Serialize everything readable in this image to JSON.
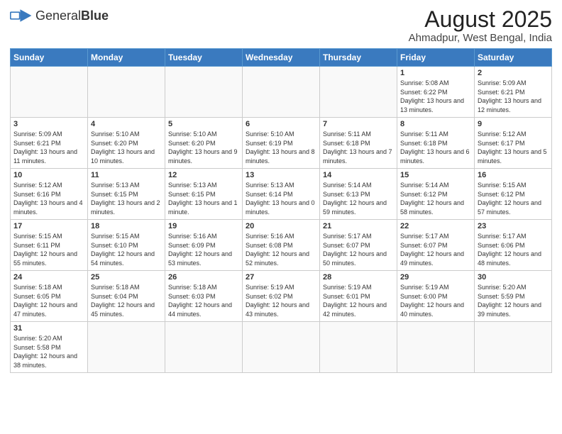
{
  "header": {
    "logo_text_normal": "General",
    "logo_text_bold": "Blue",
    "title": "August 2025",
    "subtitle": "Ahmadpur, West Bengal, India"
  },
  "weekdays": [
    "Sunday",
    "Monday",
    "Tuesday",
    "Wednesday",
    "Thursday",
    "Friday",
    "Saturday"
  ],
  "weeks": [
    [
      {
        "day": "",
        "info": ""
      },
      {
        "day": "",
        "info": ""
      },
      {
        "day": "",
        "info": ""
      },
      {
        "day": "",
        "info": ""
      },
      {
        "day": "",
        "info": ""
      },
      {
        "day": "1",
        "info": "Sunrise: 5:08 AM\nSunset: 6:22 PM\nDaylight: 13 hours and 13 minutes."
      },
      {
        "day": "2",
        "info": "Sunrise: 5:09 AM\nSunset: 6:21 PM\nDaylight: 13 hours and 12 minutes."
      }
    ],
    [
      {
        "day": "3",
        "info": "Sunrise: 5:09 AM\nSunset: 6:21 PM\nDaylight: 13 hours and 11 minutes."
      },
      {
        "day": "4",
        "info": "Sunrise: 5:10 AM\nSunset: 6:20 PM\nDaylight: 13 hours and 10 minutes."
      },
      {
        "day": "5",
        "info": "Sunrise: 5:10 AM\nSunset: 6:20 PM\nDaylight: 13 hours and 9 minutes."
      },
      {
        "day": "6",
        "info": "Sunrise: 5:10 AM\nSunset: 6:19 PM\nDaylight: 13 hours and 8 minutes."
      },
      {
        "day": "7",
        "info": "Sunrise: 5:11 AM\nSunset: 6:18 PM\nDaylight: 13 hours and 7 minutes."
      },
      {
        "day": "8",
        "info": "Sunrise: 5:11 AM\nSunset: 6:18 PM\nDaylight: 13 hours and 6 minutes."
      },
      {
        "day": "9",
        "info": "Sunrise: 5:12 AM\nSunset: 6:17 PM\nDaylight: 13 hours and 5 minutes."
      }
    ],
    [
      {
        "day": "10",
        "info": "Sunrise: 5:12 AM\nSunset: 6:16 PM\nDaylight: 13 hours and 4 minutes."
      },
      {
        "day": "11",
        "info": "Sunrise: 5:13 AM\nSunset: 6:15 PM\nDaylight: 13 hours and 2 minutes."
      },
      {
        "day": "12",
        "info": "Sunrise: 5:13 AM\nSunset: 6:15 PM\nDaylight: 13 hours and 1 minute."
      },
      {
        "day": "13",
        "info": "Sunrise: 5:13 AM\nSunset: 6:14 PM\nDaylight: 13 hours and 0 minutes."
      },
      {
        "day": "14",
        "info": "Sunrise: 5:14 AM\nSunset: 6:13 PM\nDaylight: 12 hours and 59 minutes."
      },
      {
        "day": "15",
        "info": "Sunrise: 5:14 AM\nSunset: 6:12 PM\nDaylight: 12 hours and 58 minutes."
      },
      {
        "day": "16",
        "info": "Sunrise: 5:15 AM\nSunset: 6:12 PM\nDaylight: 12 hours and 57 minutes."
      }
    ],
    [
      {
        "day": "17",
        "info": "Sunrise: 5:15 AM\nSunset: 6:11 PM\nDaylight: 12 hours and 55 minutes."
      },
      {
        "day": "18",
        "info": "Sunrise: 5:15 AM\nSunset: 6:10 PM\nDaylight: 12 hours and 54 minutes."
      },
      {
        "day": "19",
        "info": "Sunrise: 5:16 AM\nSunset: 6:09 PM\nDaylight: 12 hours and 53 minutes."
      },
      {
        "day": "20",
        "info": "Sunrise: 5:16 AM\nSunset: 6:08 PM\nDaylight: 12 hours and 52 minutes."
      },
      {
        "day": "21",
        "info": "Sunrise: 5:17 AM\nSunset: 6:07 PM\nDaylight: 12 hours and 50 minutes."
      },
      {
        "day": "22",
        "info": "Sunrise: 5:17 AM\nSunset: 6:07 PM\nDaylight: 12 hours and 49 minutes."
      },
      {
        "day": "23",
        "info": "Sunrise: 5:17 AM\nSunset: 6:06 PM\nDaylight: 12 hours and 48 minutes."
      }
    ],
    [
      {
        "day": "24",
        "info": "Sunrise: 5:18 AM\nSunset: 6:05 PM\nDaylight: 12 hours and 47 minutes."
      },
      {
        "day": "25",
        "info": "Sunrise: 5:18 AM\nSunset: 6:04 PM\nDaylight: 12 hours and 45 minutes."
      },
      {
        "day": "26",
        "info": "Sunrise: 5:18 AM\nSunset: 6:03 PM\nDaylight: 12 hours and 44 minutes."
      },
      {
        "day": "27",
        "info": "Sunrise: 5:19 AM\nSunset: 6:02 PM\nDaylight: 12 hours and 43 minutes."
      },
      {
        "day": "28",
        "info": "Sunrise: 5:19 AM\nSunset: 6:01 PM\nDaylight: 12 hours and 42 minutes."
      },
      {
        "day": "29",
        "info": "Sunrise: 5:19 AM\nSunset: 6:00 PM\nDaylight: 12 hours and 40 minutes."
      },
      {
        "day": "30",
        "info": "Sunrise: 5:20 AM\nSunset: 5:59 PM\nDaylight: 12 hours and 39 minutes."
      }
    ],
    [
      {
        "day": "31",
        "info": "Sunrise: 5:20 AM\nSunset: 5:58 PM\nDaylight: 12 hours and 38 minutes."
      },
      {
        "day": "",
        "info": ""
      },
      {
        "day": "",
        "info": ""
      },
      {
        "day": "",
        "info": ""
      },
      {
        "day": "",
        "info": ""
      },
      {
        "day": "",
        "info": ""
      },
      {
        "day": "",
        "info": ""
      }
    ]
  ]
}
